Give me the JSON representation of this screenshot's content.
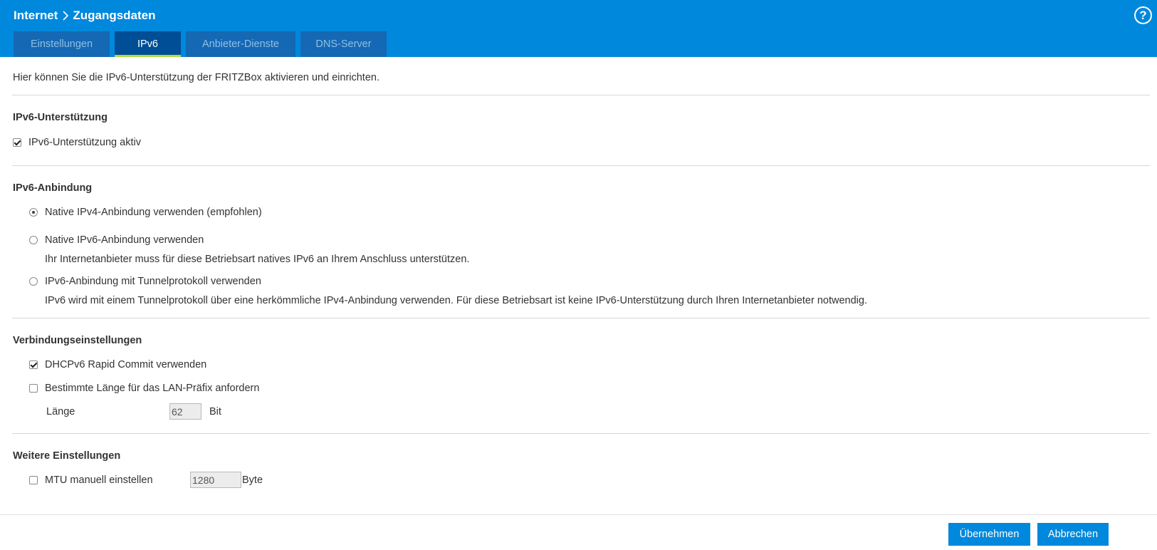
{
  "header": {
    "breadcrumb": [
      "Internet",
      "Zugangsdaten"
    ],
    "help_label": "?"
  },
  "tabs": [
    {
      "label": "Einstellungen",
      "active": false
    },
    {
      "label": "IPv6",
      "active": true
    },
    {
      "label": "Anbieter-Dienste",
      "active": false
    },
    {
      "label": "DNS-Server",
      "active": false
    }
  ],
  "intro": "Hier können Sie die IPv6-Unterstützung der FRITZBox aktivieren und einrichten.",
  "support": {
    "title": "IPv6-Unterstützung",
    "checkbox_label": "IPv6-Unterstützung aktiv",
    "checked": true
  },
  "binding": {
    "title": "IPv6-Anbindung",
    "options": [
      {
        "label": "Native IPv4-Anbindung verwenden (empfohlen)",
        "selected": true,
        "hint": ""
      },
      {
        "label": "Native IPv6-Anbindung verwenden",
        "selected": false,
        "hint": "Ihr Internetanbieter muss für diese Betriebsart natives IPv6 an Ihrem Anschluss unterstützen."
      },
      {
        "label": "IPv6-Anbindung mit Tunnelprotokoll verwenden",
        "selected": false,
        "hint": "IPv6 wird mit einem Tunnelprotokoll über eine herkömmliche IPv4-Anbindung verwenden. Für diese Betriebsart ist keine IPv6-Unterstützung durch Ihren Internetanbieter notwendig."
      }
    ]
  },
  "connection": {
    "title": "Verbindungseinstellungen",
    "rapid_commit": {
      "label": "DHCPv6 Rapid Commit verwenden",
      "checked": true
    },
    "prefix": {
      "label": "Bestimmte Länge für das LAN-Präfix anfordern",
      "checked": false
    },
    "length_label": "Länge",
    "length_value": "62",
    "length_unit": "Bit"
  },
  "further": {
    "title": "Weitere Einstellungen",
    "mtu_label": "MTU manuell einstellen",
    "mtu_checked": false,
    "mtu_value": "1280",
    "mtu_unit": "Byte"
  },
  "buttons": {
    "apply": "Übernehmen",
    "cancel": "Abbrechen"
  },
  "colors": {
    "header_bg": "#0088dc",
    "tab_bg": "#1568b3",
    "tab_active_bg": "#004e95",
    "tab_active_underline": "#b5d93e",
    "button_bg": "#0088dc"
  }
}
